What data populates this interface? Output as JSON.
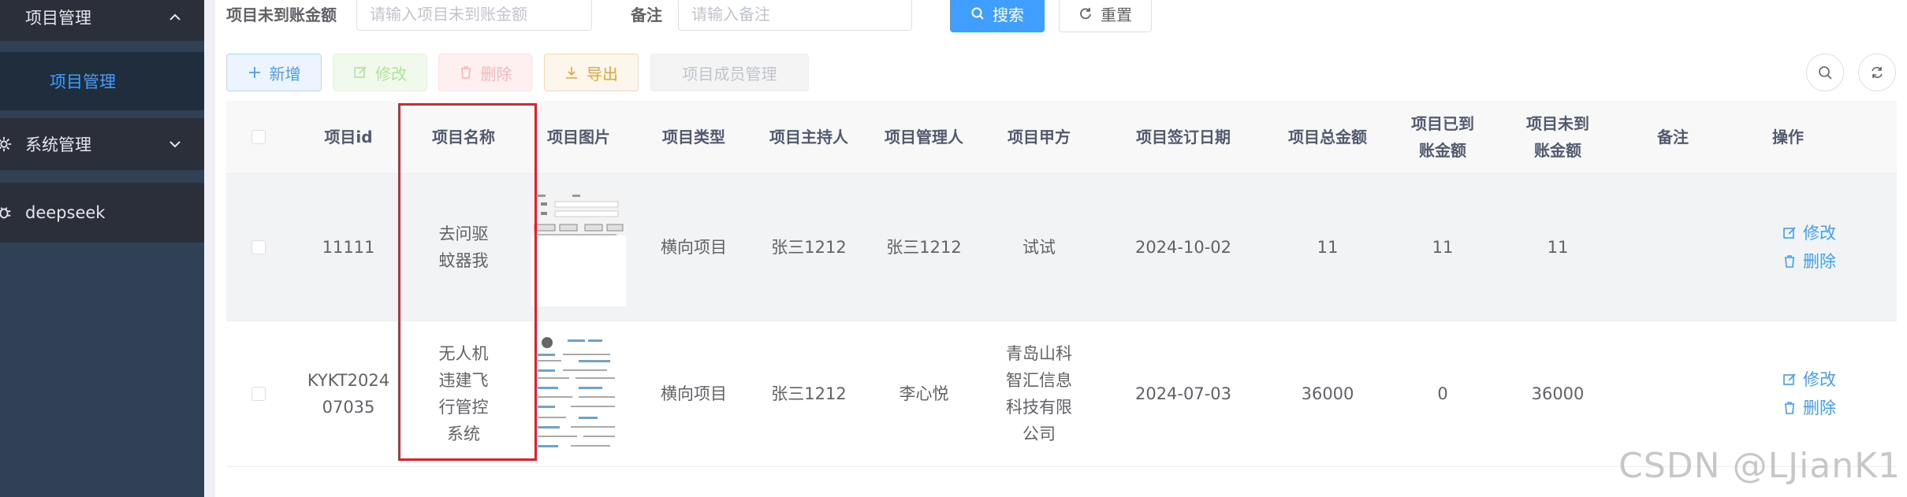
{
  "sidebar": {
    "menu_project": "项目管理",
    "sub_project": "项目管理",
    "menu_system": "系统管理",
    "menu_deepseek": "deepseek"
  },
  "search": {
    "unpaid_label": "项目未到账金额",
    "unpaid_placeholder": "请输入项目未到账金额",
    "remark_label": "备注",
    "remark_placeholder": "请输入备注",
    "search_btn": "搜索",
    "reset_btn": "重置"
  },
  "toolbar": {
    "add": "新增",
    "edit": "修改",
    "delete": "删除",
    "export": "导出",
    "members": "项目成员管理"
  },
  "table": {
    "headers": {
      "id": "项目id",
      "name": "项目名称",
      "image": "项目图片",
      "type": "项目类型",
      "host": "项目主持人",
      "manager": "项目管理人",
      "party_a": "项目甲方",
      "sign_date": "项目签订日期",
      "total": "项目总金额",
      "received": "项目已到账金额",
      "unpaid": "项目未到账金额",
      "remark": "备注",
      "ops": "操作"
    },
    "rows": [
      {
        "id": "11111",
        "name": "去问驱蚊器我",
        "type": "横向项目",
        "host": "张三1212",
        "manager": "张三1212",
        "party_a": "试试",
        "sign_date": "2024-10-02",
        "total": "11",
        "received": "11",
        "unpaid": "11",
        "remark": "",
        "edit": "修改",
        "delete": "删除"
      },
      {
        "id": "KYKT202407035",
        "name": "无人机违建飞行管控系统",
        "type": "横向项目",
        "host": "张三1212",
        "manager": "李心悦",
        "party_a": "青岛山科智汇信息科技有限公司",
        "sign_date": "2024-07-03",
        "total": "36000",
        "received": "0",
        "unpaid": "36000",
        "remark": "",
        "edit": "修改",
        "delete": "删除"
      }
    ]
  },
  "watermark": "CSDN @LJianK1",
  "colors": {
    "primary": "#409eff",
    "sidebar_bg": "#304156",
    "highlight_frame": "#e0202b"
  }
}
